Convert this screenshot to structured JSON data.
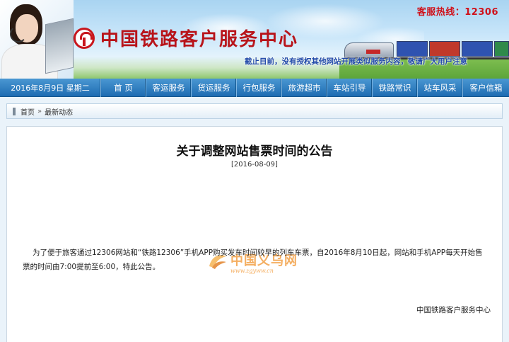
{
  "header": {
    "logo_text": "中国铁路客户服务中心",
    "hotline": "客服热线：12306",
    "banner_notice": "截止目前，没有授权其他网站开展类似服务内容，敬请广大用户注意"
  },
  "nav": {
    "date": "2016年8月9日 星期二",
    "items": [
      "首 页",
      "客运服务",
      "货运服务",
      "行包服务",
      "旅游超市",
      "车站引导",
      "铁路常识",
      "站车风采",
      "客户信箱"
    ]
  },
  "breadcrumb": {
    "home": "首页",
    "separator": "»",
    "current": "最新动态"
  },
  "article": {
    "title": "关于调整网站售票时间的公告",
    "date": "[2016-08-09]",
    "body": "为了便于旅客通过12306网站和“铁路12306”手机APP购买发车时间较早的列车车票，自2016年8月10日起，网站和手机APP每天开始售票的时间由7:00提前至6:00，特此公告。",
    "signature": "中国铁路客户服务中心"
  },
  "watermark": {
    "text": "中国义乌网",
    "url": "www.zgyww.cn"
  },
  "colors": {
    "nav_top": "#4a97d2",
    "nav_bottom": "#1e6cb2",
    "logo_red": "#b8141a",
    "hotline_red": "#d0111a",
    "notice_blue": "#2049a8",
    "watermark_orange": "#f29b3a"
  },
  "icons": {
    "logo": "railway-logo-icon",
    "breadcrumb": "home-marker-icon",
    "watermark": "watermark-logo-icon"
  }
}
